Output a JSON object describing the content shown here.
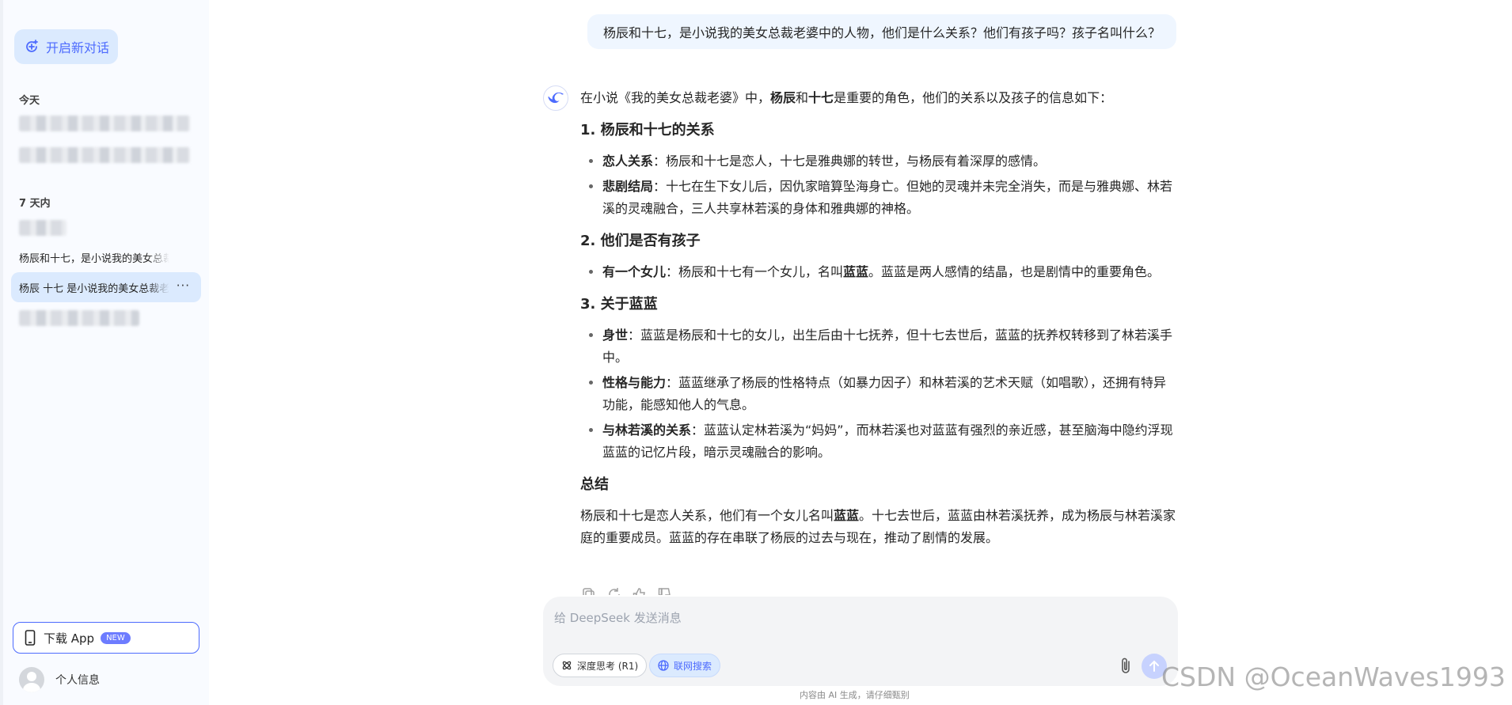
{
  "sidebar": {
    "new_chat_label": "开启新对话",
    "section_today": "今天",
    "section_week": "7 天内",
    "history": [
      {
        "label": "杨辰和十七，是小说我的美女总裁老婆中的人物"
      },
      {
        "label": "杨辰 十七 是小说我的美女总裁老婆中的人物",
        "more": "···"
      }
    ],
    "download_label": "下载 App",
    "download_badge": "NEW",
    "profile_label": "个人信息"
  },
  "chat": {
    "user_message": "杨辰和十七，是小说我的美女总裁老婆中的人物，他们是什么关系？他们有孩子吗？孩子名叫什么？",
    "answer": {
      "intro": {
        "pre": "在小说《我的美女总裁老婆》中，",
        "b1": "杨辰",
        "mid": "和",
        "b2": "十七",
        "post": "是重要的角色，他们的关系以及孩子的信息如下："
      },
      "h1": "1. 杨辰和十七的关系",
      "s1_items": [
        {
          "bold": "恋人关系",
          "text": "：杨辰和十七是恋人，十七是雅典娜的转世，与杨辰有着深厚的感情。"
        },
        {
          "bold": "悲剧结局",
          "text": "：十七在生下女儿后，因仇家暗算坠海身亡。但她的灵魂并未完全消失，而是与雅典娜、林若溪的灵魂融合，三人共享林若溪的身体和雅典娜的神格。"
        }
      ],
      "h2": "2. 他们是否有孩子",
      "s2_item": {
        "bold": "有一个女儿",
        "text": "：杨辰和十七有一个女儿，名叫",
        "name": "蓝蓝",
        "post": "。蓝蓝是两人感情的结晶，也是剧情中的重要角色。"
      },
      "h3": "3. 关于蓝蓝",
      "s3_items": [
        {
          "bold": "身世",
          "text": "：蓝蓝是杨辰和十七的女儿，出生后由十七抚养，但十七去世后，蓝蓝的抚养权转移到了林若溪手中。"
        },
        {
          "bold": "性格与能力",
          "text": "：蓝蓝继承了杨辰的性格特点（如暴力因子）和林若溪的艺术天赋（如唱歌），还拥有特异功能，能感知他人的气息。"
        },
        {
          "bold": "与林若溪的关系",
          "text": "：蓝蓝认定林若溪为“妈妈”，而林若溪也对蓝蓝有强烈的亲近感，甚至脑海中隐约浮现蓝蓝的记忆片段，暗示灵魂融合的影响。"
        }
      ],
      "h4": "总结",
      "summary": {
        "pre": "杨辰和十七是恋人关系，他们有一个女儿名叫",
        "bold": "蓝蓝",
        "post": "。十七去世后，蓝蓝由林若溪抚养，成为杨辰与林若溪家庭的重要成员。蓝蓝的存在串联了杨辰的过去与现在，推动了剧情的发展。"
      }
    }
  },
  "input": {
    "placeholder": "给 DeepSeek 发送消息",
    "deep_think_label": "深度思考 (R1)",
    "web_search_label": "联网搜索"
  },
  "disclaimer": "内容由 AI 生成，请仔细甄别",
  "watermark": "CSDN @OceanWaves1993",
  "colors": {
    "accent": "#4d6bfe",
    "sidebar_bg": "#f9fbff",
    "active_item": "#dbeafe",
    "user_bubble": "#eff6ff"
  }
}
